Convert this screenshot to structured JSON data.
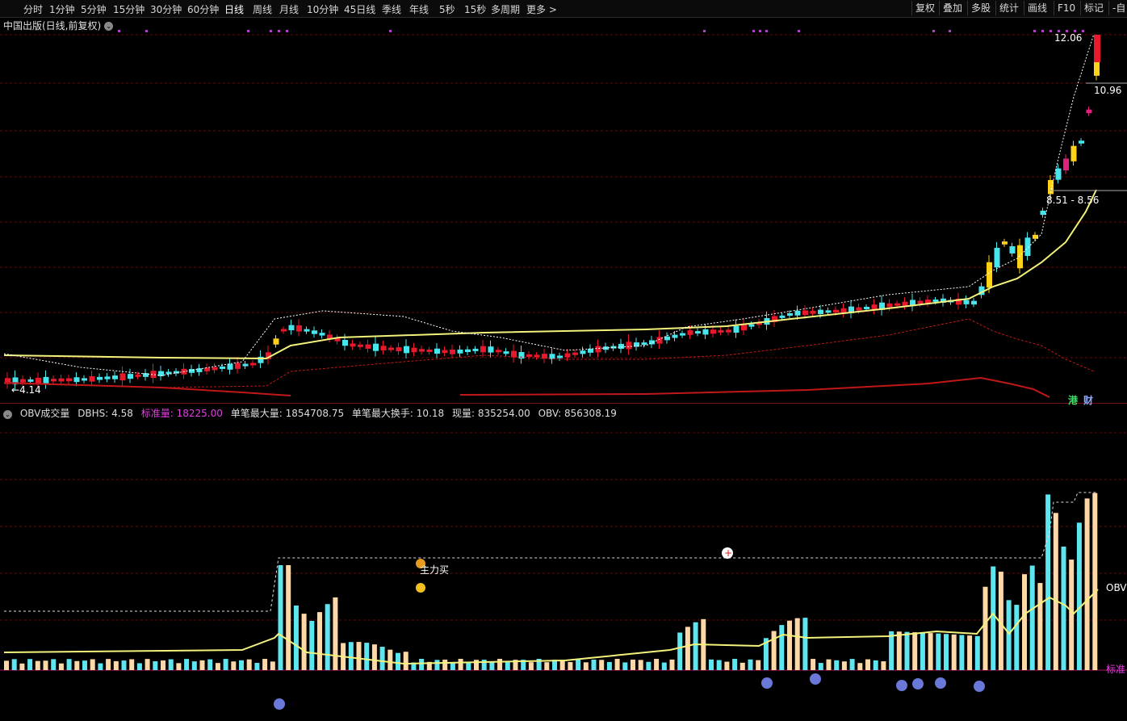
{
  "toolbar": {
    "periods": [
      "分时",
      "1分钟",
      "5分钟",
      "15分钟",
      "30分钟",
      "60分钟",
      "日线",
      "周线",
      "月线",
      "10分钟",
      "45日线",
      "季线",
      "年线",
      "5秒",
      "15秒",
      "多周期",
      "更多 >"
    ],
    "active_period": "日线",
    "right_tools": [
      "复权",
      "叠加",
      "多股",
      "统计",
      "画线",
      "F10",
      "标记",
      "-自"
    ]
  },
  "price_panel": {
    "title": "中国出版(日线,前复权)",
    "labels": {
      "high": "12.06",
      "pre_high": "10.96",
      "range": "8.51 - 8.56",
      "low": "4.14",
      "gang": "港",
      "cai": "财"
    },
    "colors": {
      "up": "#e8182d",
      "down": "#49e5ec",
      "ma": "#f2f27c",
      "boll": "#ffffff",
      "lower": "#c01818",
      "gold": "#ffd21a",
      "magenta": "#e0207a",
      "dots": "#b042c8"
    }
  },
  "indicator": {
    "name": "OBV成交量",
    "dbhs_label": "DBHS:",
    "dbhs_value": "4.58",
    "std_label": "标准量:",
    "std_value": "18225.00",
    "maxvol_label": "单笔最大量:",
    "maxvol_value": "1854708.75",
    "maxturn_label": "单笔最大换手:",
    "maxturn_value": "10.18",
    "cur_label": "现量:",
    "cur_value": "835254.00",
    "obv_label": "OBV:",
    "obv_value": "856308.19",
    "annotation": "主力买",
    "right_obv": "OBV",
    "right_std": "标准",
    "colors": {
      "std": "#e040e0",
      "up": "#ffd8a8",
      "down": "#5ee6f0",
      "obv": "#f2f27c"
    }
  }
}
